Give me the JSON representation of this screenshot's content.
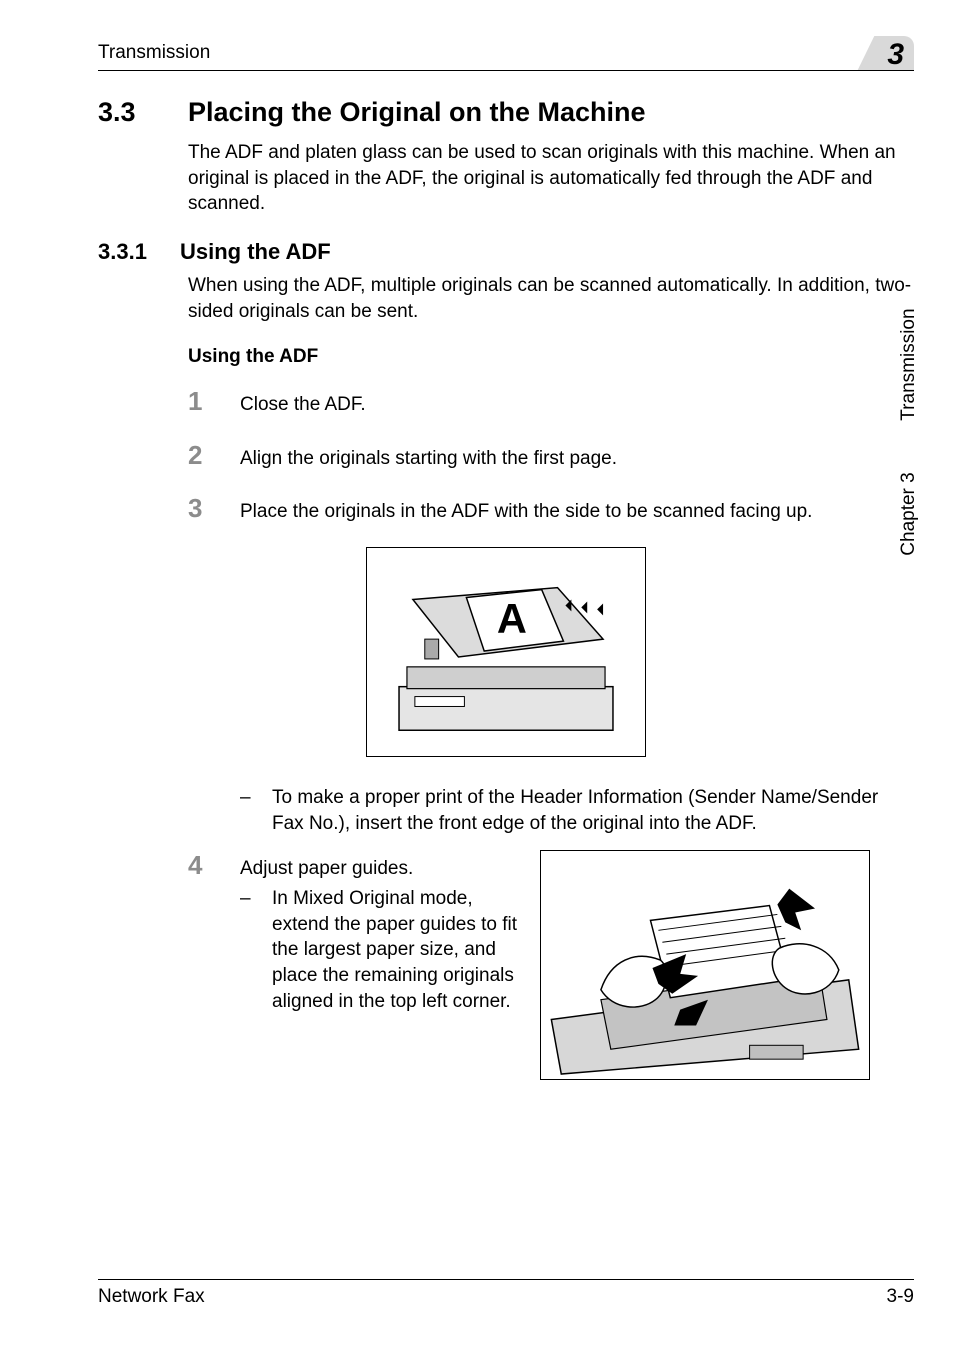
{
  "header": {
    "running_head": "Transmission",
    "chapter_badge": "3"
  },
  "side": {
    "chapter": "Chapter 3",
    "section": "Transmission"
  },
  "section": {
    "number": "3.3",
    "title": "Placing the Original on the Machine",
    "intro": "The ADF and platen glass can be used to scan originals with this machine. When an original is placed in the ADF, the original is automatically fed through the ADF and scanned."
  },
  "subsection": {
    "number": "3.3.1",
    "title": "Using the ADF",
    "intro": "When using the ADF, multiple originals can be scanned automatically. In addition, two-sided originals can be sent."
  },
  "procedure": {
    "title": "Using the ADF",
    "steps": {
      "s1": {
        "num": "1",
        "text": "Close the ADF."
      },
      "s2": {
        "num": "2",
        "text": "Align the originals starting with the first page."
      },
      "s3": {
        "num": "3",
        "text": "Place the originals in the ADF with the side to be scanned facing up."
      },
      "s3_note": "To make a proper print of the Header Information (Sender Name/Sender Fax No.), insert the front edge of the original into the ADF.",
      "s4": {
        "num": "4",
        "text": "Adjust paper guides."
      },
      "s4_note": "In Mixed Original mode, extend the paper guides to fit the largest paper size, and place the remaining originals aligned in the top left corner."
    }
  },
  "figure1": {
    "letter": "A"
  },
  "footer": {
    "left": "Network Fax",
    "right": "3-9"
  }
}
